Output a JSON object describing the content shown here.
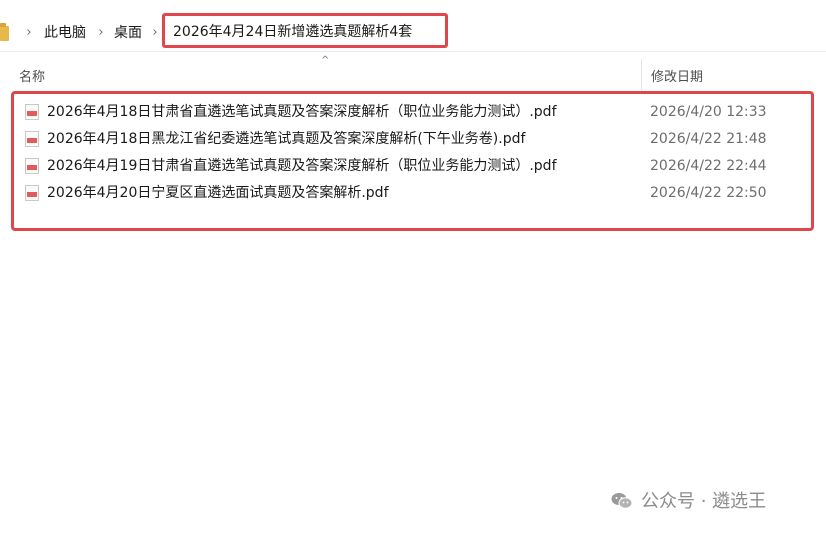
{
  "address_bar": {
    "crumbs": [
      "此电脑",
      "桌面"
    ],
    "current": "2026年4月24日新增遴选真题解析4套"
  },
  "columns": {
    "name": "名称",
    "date_modified": "修改日期"
  },
  "files": [
    {
      "name": "2026年4月18日甘肃省直遴选笔试真题及答案深度解析（职位业务能力测试）.pdf",
      "date": "2026/4/20 12:33",
      "icon": "pdf-file-icon"
    },
    {
      "name": "2026年4月18日黑龙江省纪委遴选笔试真题及答案深度解析(下午业务卷).pdf",
      "date": "2026/4/22 21:48",
      "icon": "pdf-file-icon"
    },
    {
      "name": "2026年4月19日甘肃省直遴选笔试真题及答案深度解析（职位业务能力测试）.pdf",
      "date": "2026/4/22 22:44",
      "icon": "pdf-file-icon"
    },
    {
      "name": "2026年4月20日宁夏区直遴选面试真题及答案解析.pdf",
      "date": "2026/4/22 22:50",
      "icon": "pdf-file-icon"
    }
  ],
  "watermark": {
    "text": "公众号 · 遴选王",
    "icon": "wechat-icon"
  },
  "colors": {
    "highlight": "#e0474c",
    "date_text": "#6d6d6d"
  }
}
